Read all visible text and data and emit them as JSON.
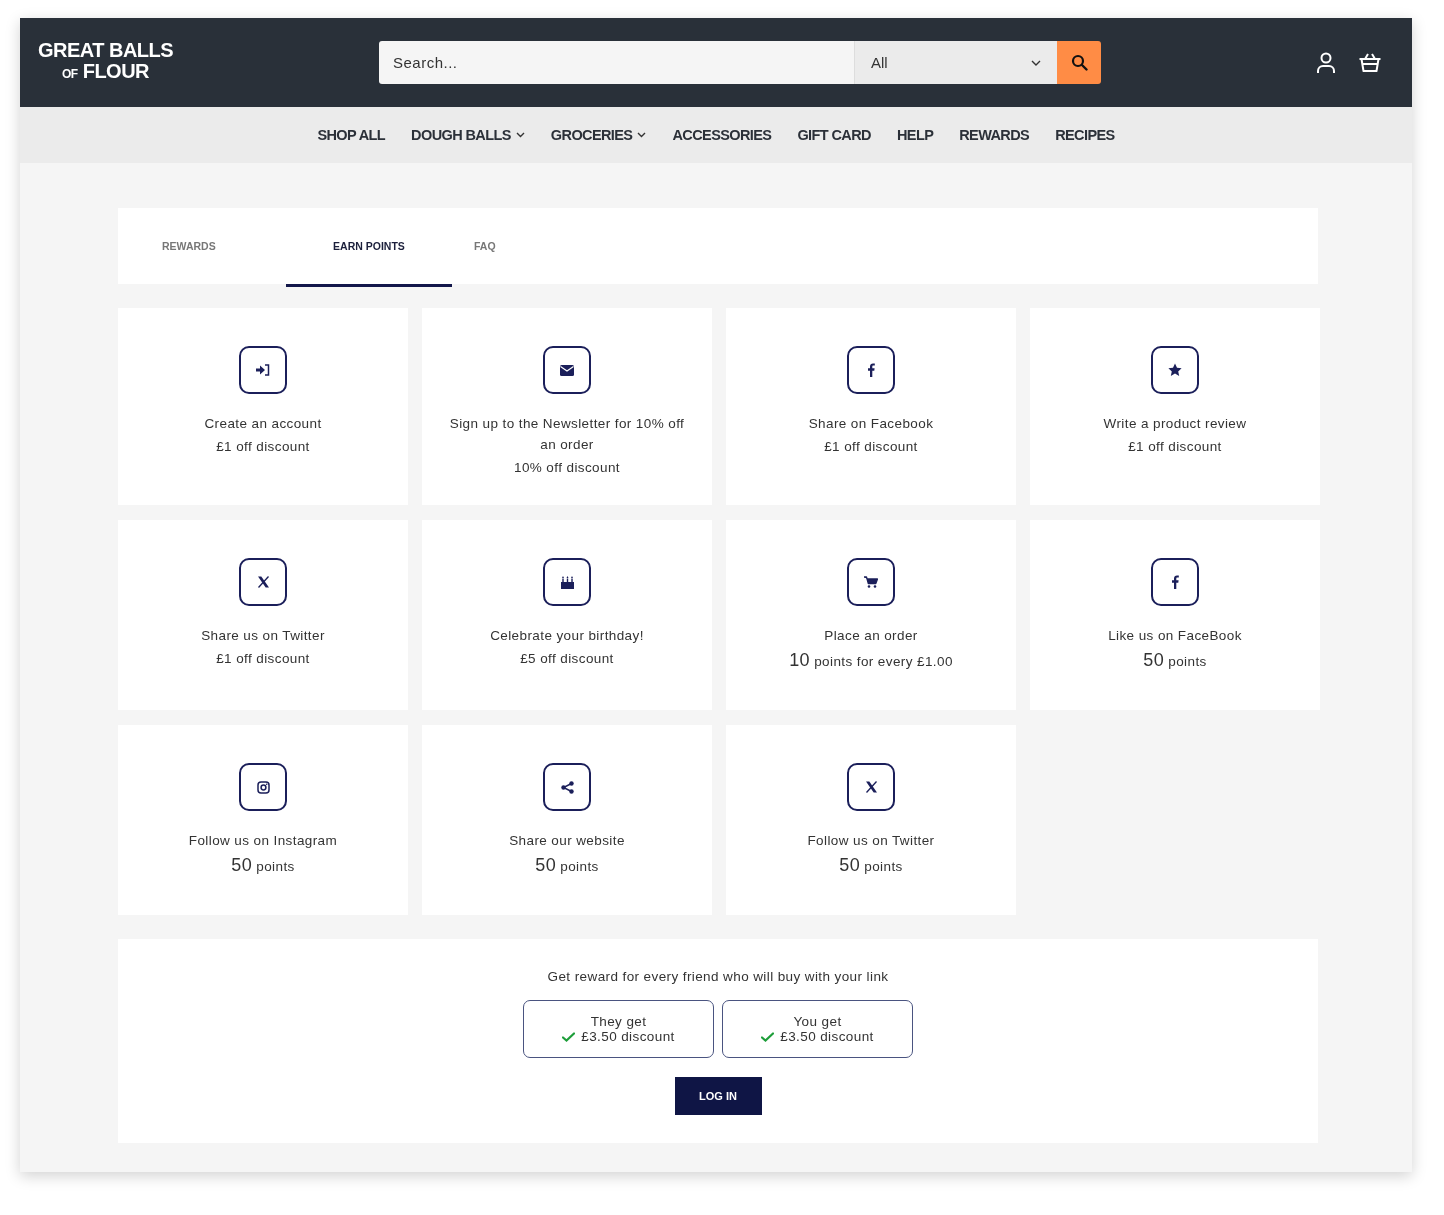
{
  "logo": {
    "line_1": "GREAT BALLS",
    "small": "OF",
    "line_2": "FLOUR"
  },
  "search": {
    "placeholder": "Search...",
    "category": "All"
  },
  "nav": [
    {
      "label": "SHOP ALL",
      "dropdown": false
    },
    {
      "label": "DOUGH BALLS",
      "dropdown": true
    },
    {
      "label": "GROCERIES",
      "dropdown": true
    },
    {
      "label": "ACCESSORIES",
      "dropdown": false
    },
    {
      "label": "GIFT CARD",
      "dropdown": false
    },
    {
      "label": "HELP",
      "dropdown": false
    },
    {
      "label": "REWARDS",
      "dropdown": false
    },
    {
      "label": "RECIPES",
      "dropdown": false
    }
  ],
  "tabs": [
    {
      "label": "REWARDS",
      "selected": false
    },
    {
      "label": "EARN POINTS",
      "selected": true
    },
    {
      "label": "FAQ",
      "selected": false
    }
  ],
  "cards": [
    {
      "title": "Create an account",
      "kind": "text",
      "reward": "£1 off discount"
    },
    {
      "title": "Sign up to the Newsletter for 10% off an order",
      "kind": "text",
      "reward": "10% off discount"
    },
    {
      "title": "Share on Facebook",
      "kind": "text",
      "reward": "£1 off discount"
    },
    {
      "title": "Write a product review",
      "kind": "text",
      "reward": "£1 off discount"
    },
    {
      "title": "Share us on Twitter",
      "kind": "text",
      "reward": "£1 off discount"
    },
    {
      "title": "Celebrate your birthday!",
      "kind": "text",
      "reward": "£5 off discount"
    },
    {
      "title": "Place an order",
      "kind": "points",
      "amount": "10",
      "unit": "points for every £1.00"
    },
    {
      "title": "Like us on FaceBook",
      "kind": "points",
      "amount": "50",
      "unit": "points"
    },
    {
      "title": "Follow us on Instagram",
      "kind": "points",
      "amount": "50",
      "unit": "points"
    },
    {
      "title": "Share our website",
      "kind": "points",
      "amount": "50",
      "unit": "points"
    },
    {
      "title": "Follow us on Twitter",
      "kind": "points",
      "amount": "50",
      "unit": "points"
    }
  ],
  "referral": {
    "text": "Get reward for every friend who will buy with your link",
    "boxes": [
      {
        "label": "They get",
        "reward": "£3.50 discount"
      },
      {
        "label": "You get",
        "reward": "£3.50 discount"
      }
    ],
    "button": "LOG IN"
  }
}
